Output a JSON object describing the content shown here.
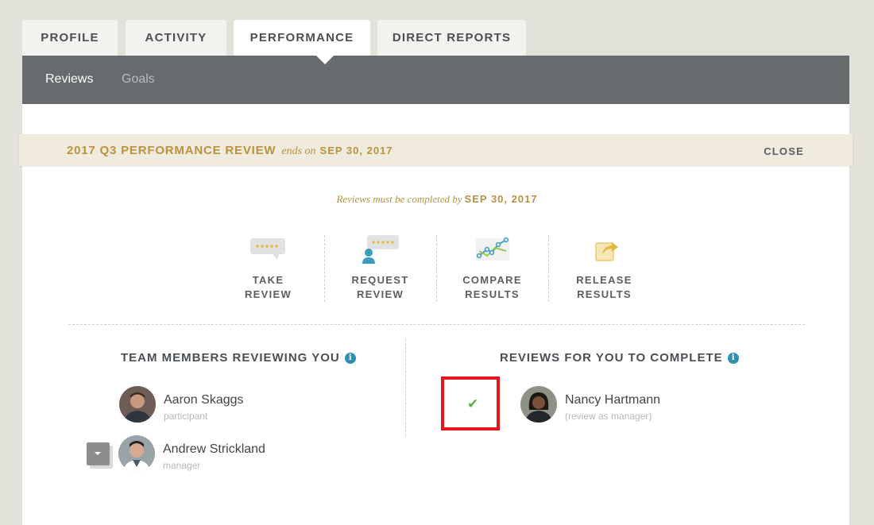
{
  "tabs": [
    {
      "label": "PROFILE",
      "active": false
    },
    {
      "label": "ACTIVITY",
      "active": false
    },
    {
      "label": "PERFORMANCE",
      "active": true
    },
    {
      "label": "DIRECT REPORTS",
      "active": false
    }
  ],
  "subnav": {
    "items": [
      {
        "label": "Reviews",
        "active": true
      },
      {
        "label": "Goals",
        "active": false
      }
    ]
  },
  "review": {
    "title": "2017 Q3 PERFORMANCE REVIEW",
    "ends_label": "ends on",
    "end_date": "SEP 30, 2017",
    "close_label": "CLOSE",
    "deadline_note": "Reviews must be completed by",
    "deadline_date": "SEP 30, 2017"
  },
  "actions": [
    {
      "label": "TAKE\nREVIEW",
      "icon": "rating-bubble-icon"
    },
    {
      "label": "REQUEST\nREVIEW",
      "icon": "person-rating-icon"
    },
    {
      "label": "COMPARE\nRESULTS",
      "icon": "line-graph-icon"
    },
    {
      "label": "RELEASE\nRESULTS",
      "icon": "share-icon"
    }
  ],
  "team_reviewing": {
    "heading": "TEAM MEMBERS REVIEWING YOU",
    "members": [
      {
        "name": "Aaron Skaggs",
        "role": "participant"
      },
      {
        "name": "Andrew Strickland",
        "role": "manager"
      }
    ]
  },
  "to_complete": {
    "heading": "REVIEWS FOR YOU TO COMPLETE",
    "members": [
      {
        "name": "Nancy Hartmann",
        "role": "(review as manager)"
      }
    ]
  },
  "colors": {
    "accent_gold": "#b89241",
    "subnav_bg": "#676b6e",
    "info_blue": "#2e8fae",
    "check_green": "#5fb14a",
    "highlight_red": "#e8151b"
  }
}
